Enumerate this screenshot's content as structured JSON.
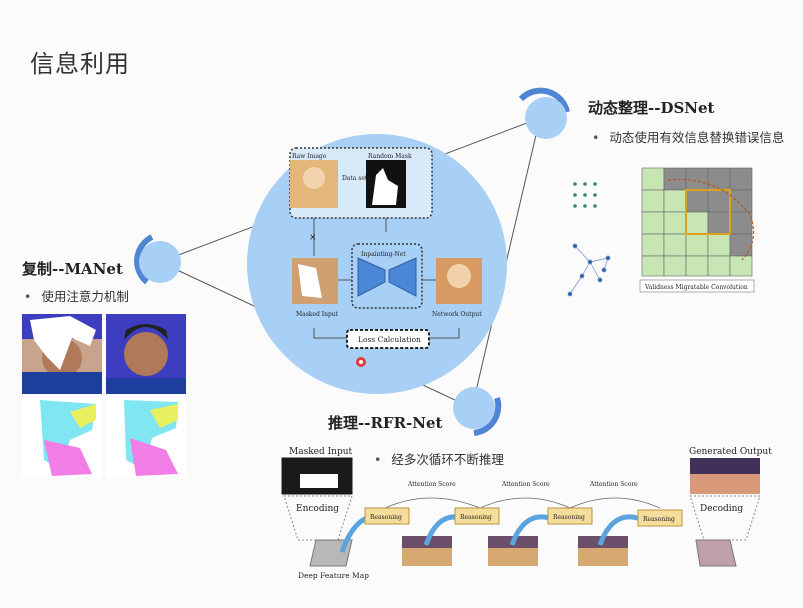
{
  "slide": {
    "title": "信息利用"
  },
  "dsnet": {
    "title": "动态整理--DSNet",
    "bullet": "动态使用有效信息替换错误信息",
    "figure_caption": "Validness Migratable Convolution"
  },
  "manet": {
    "title": "复制--MANet",
    "bullet": "使用注意力机制"
  },
  "rfrnet": {
    "title": "推理--RFR-Net",
    "bullet": "经多次循环不断推理",
    "masked_input": "Masked Input",
    "generated_output": "Generated Output",
    "encoding": "Encoding",
    "decoding": "Decoding",
    "deep_feature_map": "Deep Feature Map",
    "reasoning": "Reasoning",
    "attention_score": "Attention Score"
  },
  "center": {
    "raw_image": "Raw Image",
    "random_mask": "Random Mask",
    "data_sets": "Data sets",
    "inpainting_net": "Inpainting-Net",
    "masked_input": "Masked Input",
    "network_output": "Network Output",
    "loss_calculation": "Loss Calculation"
  },
  "colors": {
    "circle_fill": "#a8cff5",
    "ring": "#4f86d4",
    "net_blue": "#4a87d6",
    "reason_box": "#f6dd9c",
    "grid_green": "#c7e6b3",
    "grid_gray": "#8c8c8c"
  }
}
